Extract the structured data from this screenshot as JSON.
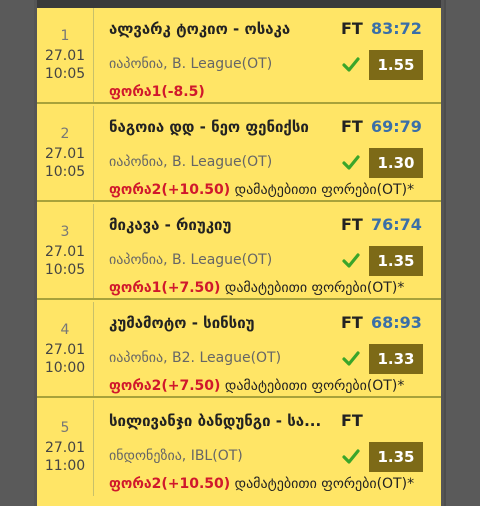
{
  "matches": [
    {
      "index": "1",
      "date": "27.01",
      "time": "10:05",
      "teams": "ალვარკ ტოკიო - ოსაკა",
      "status": "FT",
      "score": "83:72",
      "league": "იაპონია, B. League(OT)",
      "odds": "1.55",
      "bet": "ფორა1(-8.5)",
      "bet_note": ""
    },
    {
      "index": "2",
      "date": "27.01",
      "time": "10:05",
      "teams": "ნაგოია დდ - ნეო ფენიქსი",
      "status": "FT",
      "score": "69:79",
      "league": "იაპონია, B. League(OT)",
      "odds": "1.30",
      "bet": "ფორა2(+10.50)",
      "bet_note": "დამატებითი ფორები(OT)*"
    },
    {
      "index": "3",
      "date": "27.01",
      "time": "10:05",
      "teams": "მიკავა - რიუკიუ",
      "status": "FT",
      "score": "76:74",
      "league": "იაპონია, B. League(OT)",
      "odds": "1.35",
      "bet": "ფორა1(+7.50)",
      "bet_note": "დამატებითი ფორები(OT)*"
    },
    {
      "index": "4",
      "date": "27.01",
      "time": "10:00",
      "teams": "კუმამოტო - სინსიუ",
      "status": "FT",
      "score": "68:93",
      "league": "იაპონია, B2. League(OT)",
      "odds": "1.33",
      "bet": "ფორა2(+7.50)",
      "bet_note": "დამატებითი ფორები(OT)*"
    },
    {
      "index": "5",
      "date": "27.01",
      "time": "11:00",
      "teams": "სილივანჯი ბანდუნგი - სა...",
      "status": "FT",
      "score": "",
      "league": "ინდონეზია, IBL(OT)",
      "odds": "1.35",
      "bet": "ფორა2(+10.50)",
      "bet_note": "დამატებითი ფორები(OT)*"
    }
  ],
  "icons": {
    "win": "check-icon"
  },
  "colors": {
    "background": "#ffe566",
    "score": "#3a6fa8",
    "bet": "#d0182c",
    "odds_bg": "#7d6a17",
    "check": "#3aa52a"
  }
}
